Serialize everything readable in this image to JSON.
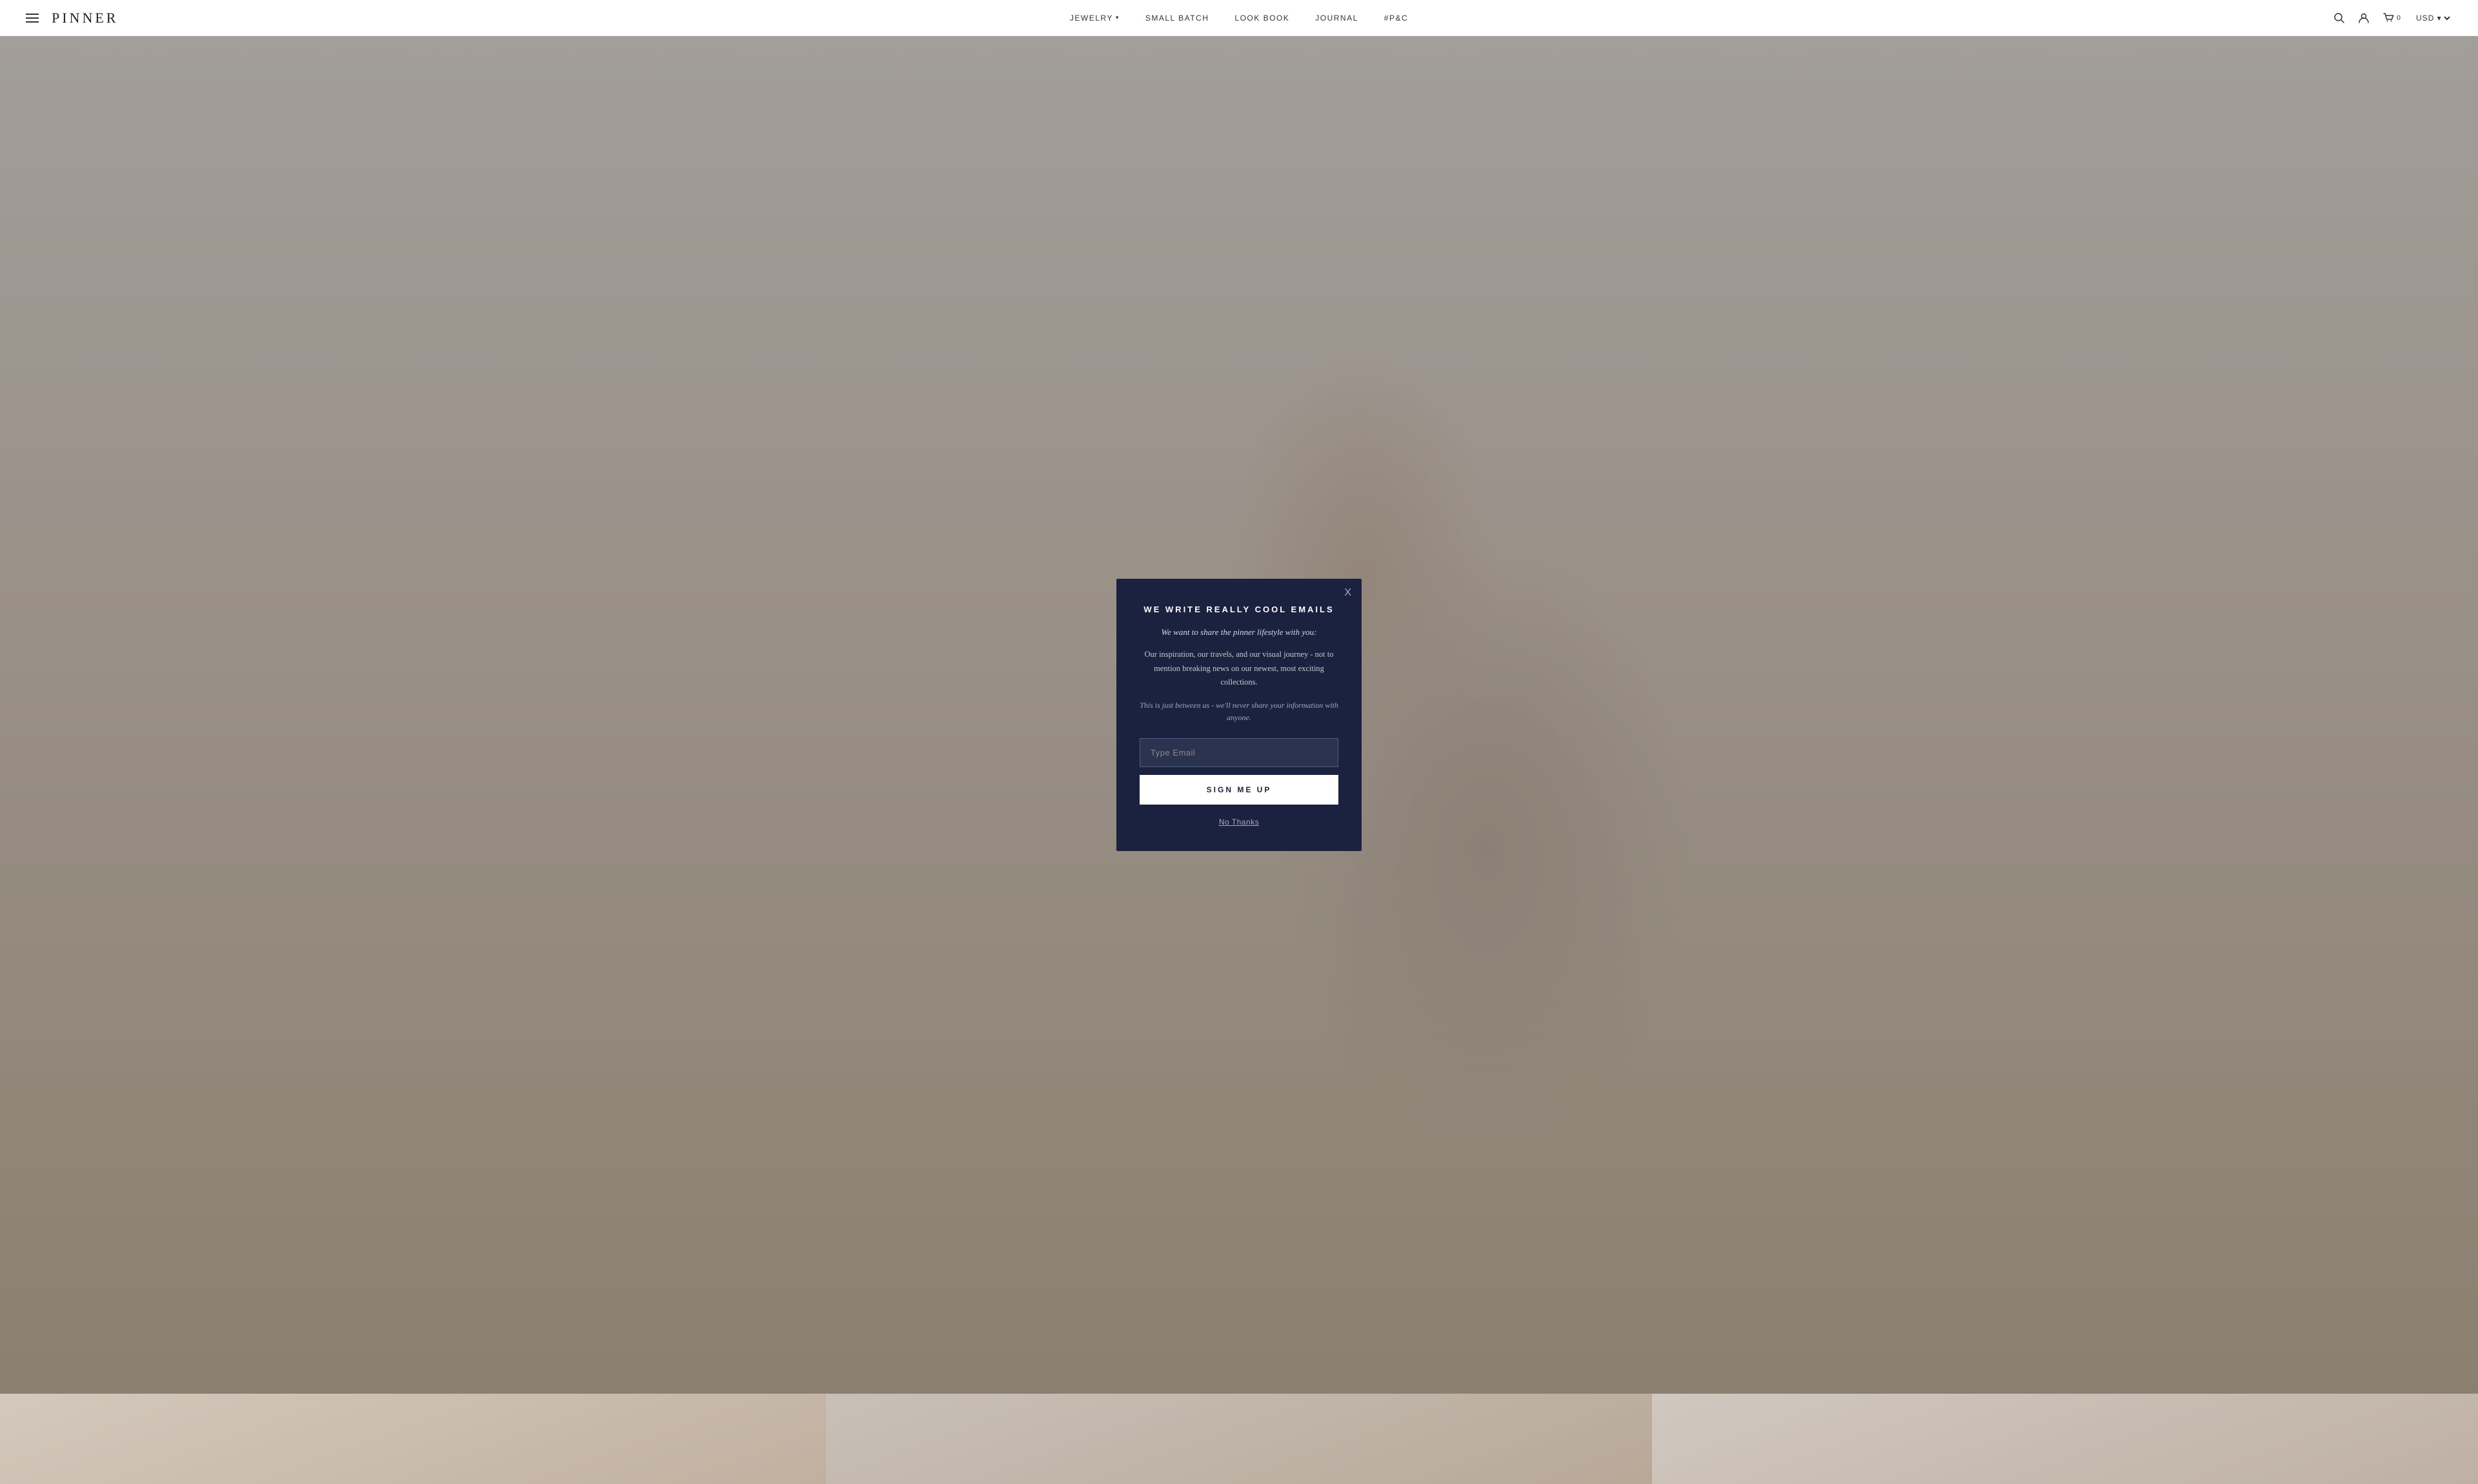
{
  "header": {
    "menu_icon_label": "menu",
    "logo": "PINNER",
    "nav": [
      {
        "id": "jewelry",
        "label": "JEWELRY",
        "has_dropdown": true
      },
      {
        "id": "small_batch",
        "label": "SMALL BATCH",
        "has_dropdown": false
      },
      {
        "id": "look_book",
        "label": "LOOK BOOK",
        "has_dropdown": false
      },
      {
        "id": "journal",
        "label": "JOURNAL",
        "has_dropdown": false
      },
      {
        "id": "hp_c",
        "label": "#P&C",
        "has_dropdown": false
      }
    ],
    "search_label": "search",
    "account_label": "account",
    "cart_label": "cart",
    "cart_count": "0",
    "currency": "USD"
  },
  "modal": {
    "close_label": "X",
    "title": "WE WRITE REALLY COOL EMAILS",
    "subtitle": "We want to share the pinner lifestyle with you:",
    "body": "Our inspiration, our travels, and our visual journey - not to mention breaking news on our newest, most exciting collections.",
    "privacy": "This is just between us - we'll never share your information with anyone.",
    "email_placeholder": "Type Email",
    "sign_up_label": "SIGN ME UP",
    "no_thanks_label": "No Thanks"
  },
  "colors": {
    "modal_bg": "#1a2240",
    "modal_text": "#ffffff",
    "button_bg": "#ffffff",
    "button_text": "#1a2240"
  }
}
